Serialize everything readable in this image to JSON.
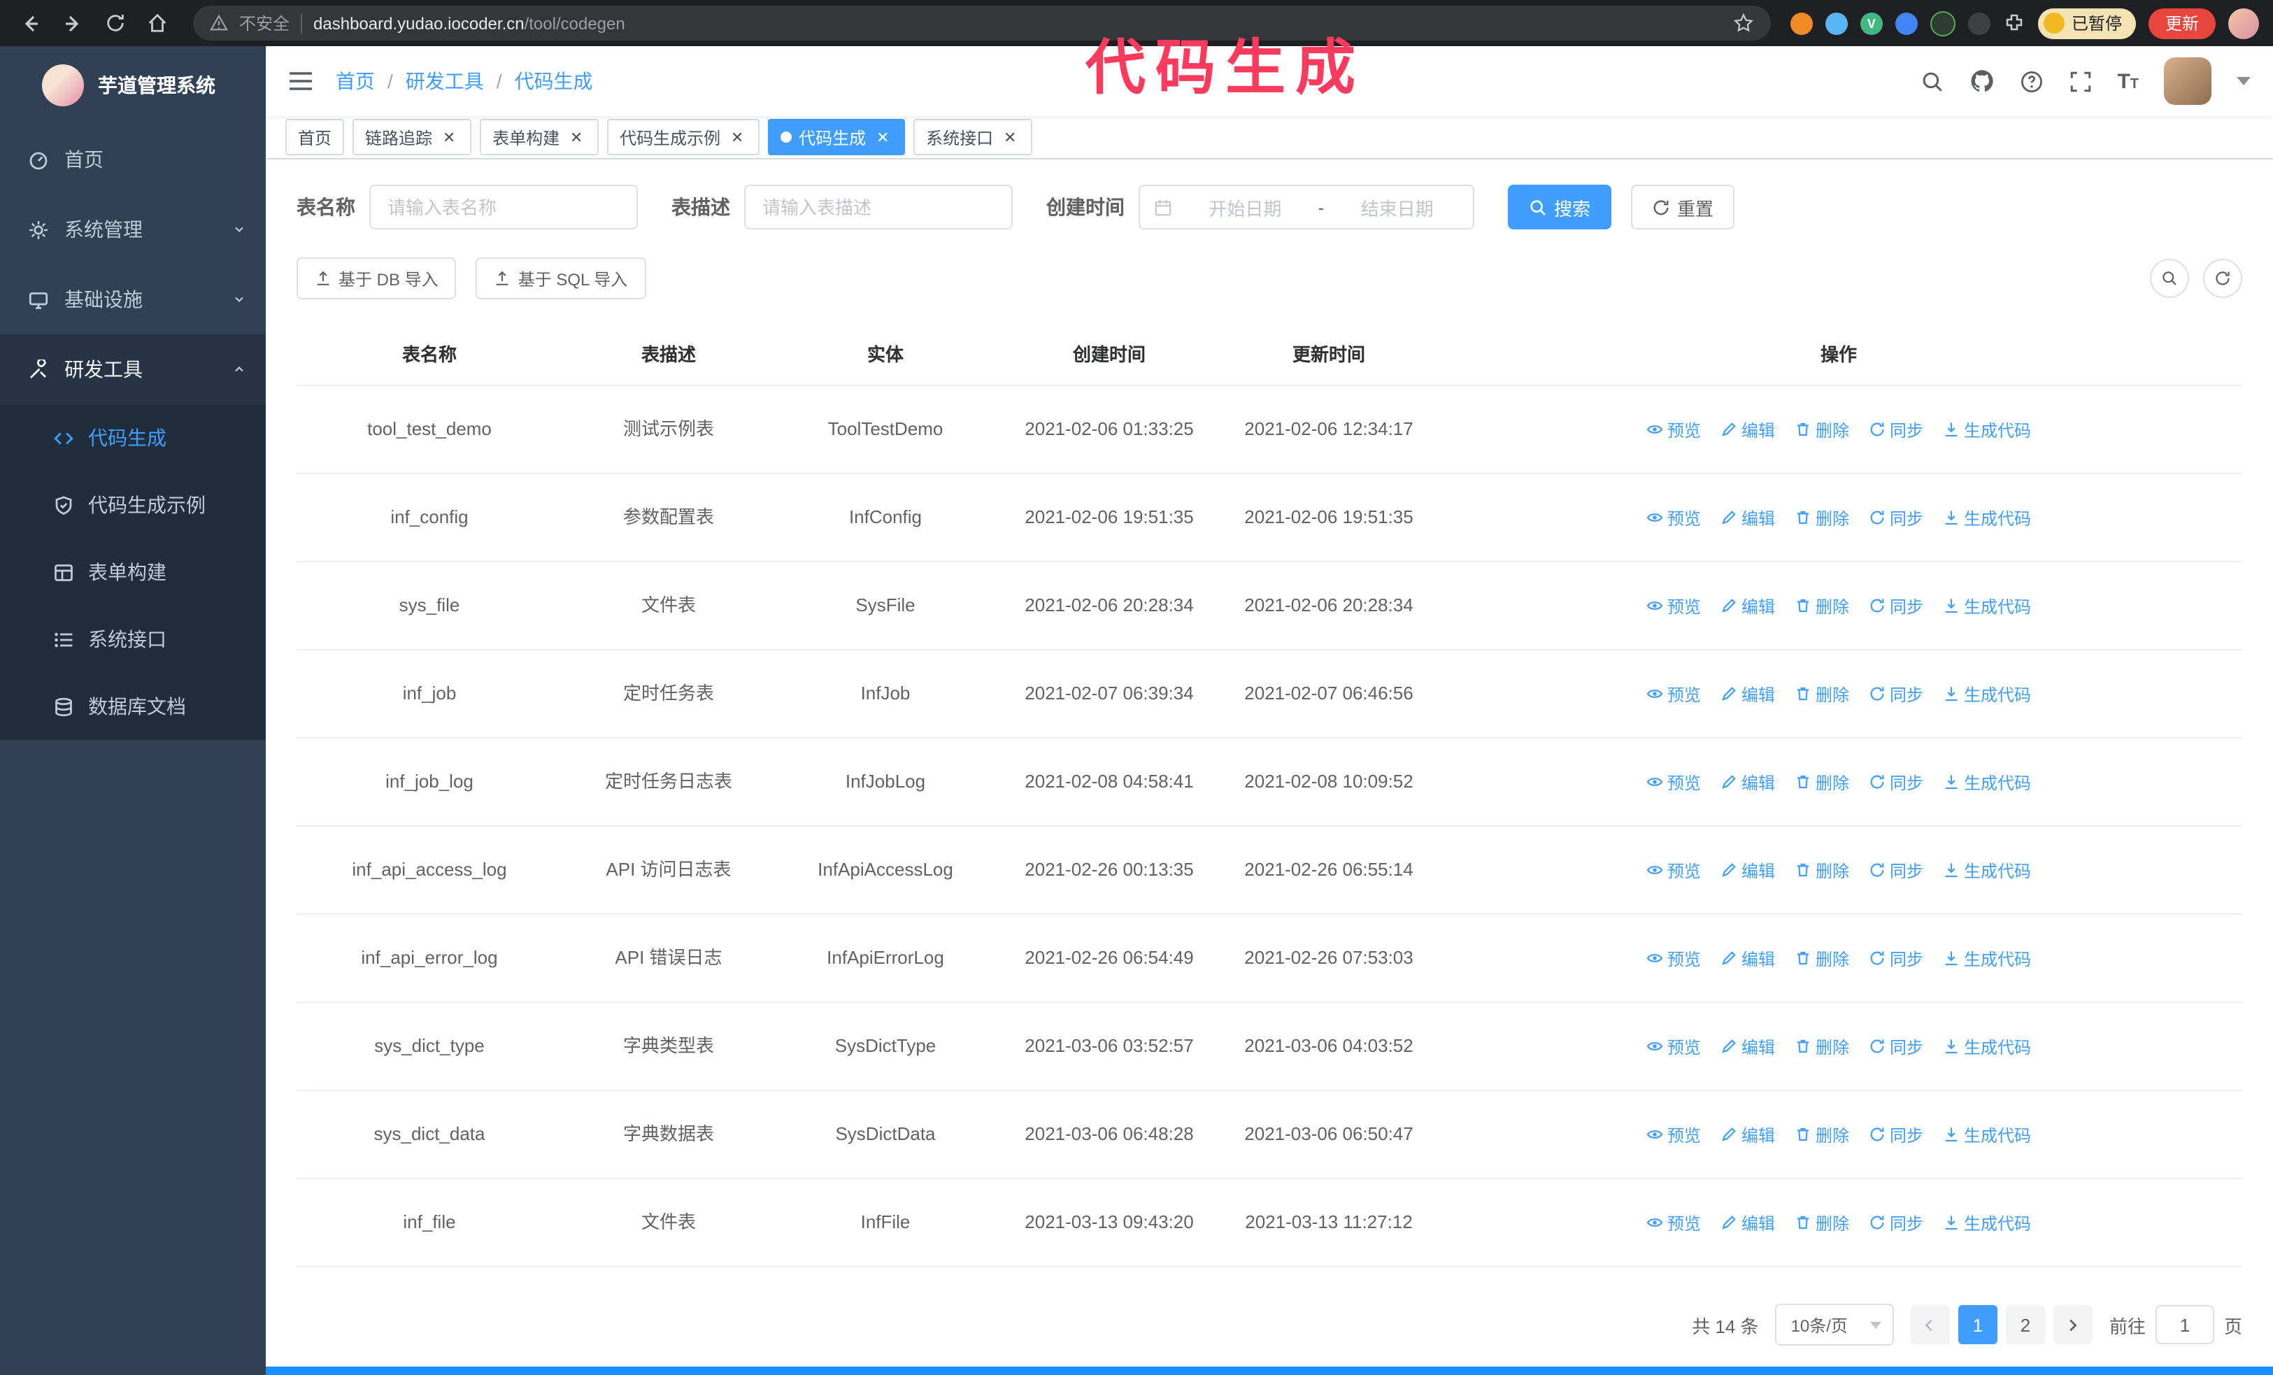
{
  "colors": {
    "accent": "#409eff",
    "sidebar_bg": "#304156",
    "submenu_bg": "#1f2d3d",
    "annotation": "#fb3b5e",
    "update_button_bg": "#e8453c",
    "tab_active_bg": "#409eff"
  },
  "chrome": {
    "not_secure": "不安全",
    "url_host": "dashboard.yudao.iocoder.cn",
    "url_path": "/tool/codegen",
    "paused_badge": "已暂停",
    "update_button": "更新",
    "vue_badge": "V"
  },
  "annotation": "代码生成",
  "sidebar": {
    "title": "芋道管理系统",
    "items": [
      {
        "label": "首页",
        "icon": "dashboard-icon"
      },
      {
        "label": "系统管理",
        "icon": "gear-icon"
      },
      {
        "label": "基础设施",
        "icon": "monitor-icon"
      },
      {
        "label": "研发工具",
        "icon": "tools-icon"
      }
    ],
    "subitems": [
      {
        "label": "代码生成",
        "icon": "code-icon"
      },
      {
        "label": "代码生成示例",
        "icon": "shield-icon"
      },
      {
        "label": "表单构建",
        "icon": "form-icon"
      },
      {
        "label": "系统接口",
        "icon": "list-icon"
      },
      {
        "label": "数据库文档",
        "icon": "database-icon"
      }
    ]
  },
  "breadcrumb": [
    "首页",
    "研发工具",
    "代码生成"
  ],
  "tabs": [
    {
      "label": "首页",
      "closable": false,
      "active": false
    },
    {
      "label": "链路追踪",
      "closable": true,
      "active": false
    },
    {
      "label": "表单构建",
      "closable": true,
      "active": false
    },
    {
      "label": "代码生成示例",
      "closable": true,
      "active": false
    },
    {
      "label": "代码生成",
      "closable": true,
      "active": true
    },
    {
      "label": "系统接口",
      "closable": true,
      "active": false
    }
  ],
  "filters": {
    "name_label": "表名称",
    "name_placeholder": "请输入表名称",
    "desc_label": "表描述",
    "desc_placeholder": "请输入表描述",
    "time_label": "创建时间",
    "start_placeholder": "开始日期",
    "range_separator": "-",
    "end_placeholder": "结束日期",
    "search_button": "搜索",
    "reset_button": "重置"
  },
  "toolbar": {
    "import_db": "基于 DB 导入",
    "import_sql": "基于 SQL 导入"
  },
  "table": {
    "columns": [
      "表名称",
      "表描述",
      "实体",
      "创建时间",
      "更新时间",
      "操作"
    ],
    "actions": [
      {
        "name": "preview",
        "label": "预览",
        "icon": "eye"
      },
      {
        "name": "edit",
        "label": "编辑",
        "icon": "edit"
      },
      {
        "name": "delete",
        "label": "删除",
        "icon": "trash"
      },
      {
        "name": "sync",
        "label": "同步",
        "icon": "sync"
      },
      {
        "name": "generate-code",
        "label": "生成代码",
        "icon": "download"
      }
    ],
    "rows": [
      [
        "tool_test_demo",
        "测试示例表",
        "ToolTestDemo",
        "2021-02-06 01:33:25",
        "2021-02-06 12:34:17"
      ],
      [
        "inf_config",
        "参数配置表",
        "InfConfig",
        "2021-02-06 19:51:35",
        "2021-02-06 19:51:35"
      ],
      [
        "sys_file",
        "文件表",
        "SysFile",
        "2021-02-06 20:28:34",
        "2021-02-06 20:28:34"
      ],
      [
        "inf_job",
        "定时任务表",
        "InfJob",
        "2021-02-07 06:39:34",
        "2021-02-07 06:46:56"
      ],
      [
        "inf_job_log",
        "定时任务日志表",
        "InfJobLog",
        "2021-02-08 04:58:41",
        "2021-02-08 10:09:52"
      ],
      [
        "inf_api_access_log",
        "API 访问日志表",
        "InfApiAccessLog",
        "2021-02-26 00:13:35",
        "2021-02-26 06:55:14"
      ],
      [
        "inf_api_error_log",
        "API 错误日志",
        "InfApiErrorLog",
        "2021-02-26 06:54:49",
        "2021-02-26 07:53:03"
      ],
      [
        "sys_dict_type",
        "字典类型表",
        "SysDictType",
        "2021-03-06 03:52:57",
        "2021-03-06 04:03:52"
      ],
      [
        "sys_dict_data",
        "字典数据表",
        "SysDictData",
        "2021-03-06 06:48:28",
        "2021-03-06 06:50:47"
      ],
      [
        "inf_file",
        "文件表",
        "InfFile",
        "2021-03-13 09:43:20",
        "2021-03-13 11:27:12"
      ]
    ]
  },
  "pagination": {
    "total": "共 14 条",
    "page_size": "10条/页",
    "pages": [
      "1",
      "2"
    ],
    "active_page": "1",
    "goto_label": "前往",
    "goto_value": "1",
    "goto_suffix": "页"
  }
}
